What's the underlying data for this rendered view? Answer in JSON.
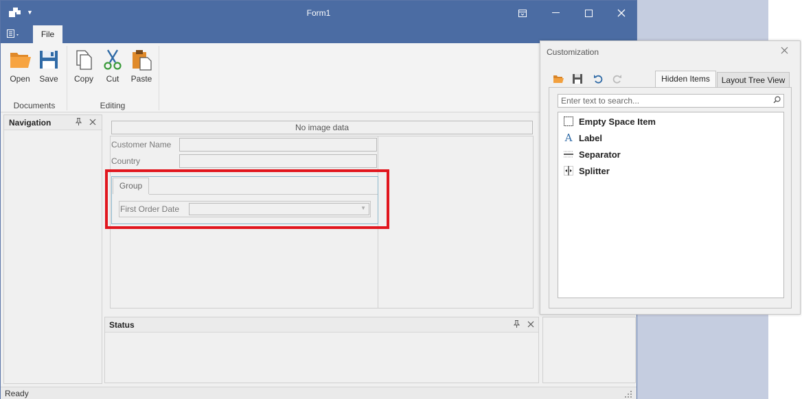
{
  "window": {
    "title": "Form1",
    "ribbon_tab_file": "File",
    "accent": "#4b6ca3"
  },
  "ribbon": {
    "groups": [
      {
        "label": "Documents",
        "buttons": [
          {
            "label": "Open",
            "icon": "folder-open-icon"
          },
          {
            "label": "Save",
            "icon": "floppy-disk-icon"
          }
        ]
      },
      {
        "label": "Editing",
        "buttons": [
          {
            "label": "Copy",
            "icon": "copy-icon"
          },
          {
            "label": "Cut",
            "icon": "scissors-icon"
          },
          {
            "label": "Paste",
            "icon": "clipboard-paste-icon"
          }
        ]
      }
    ]
  },
  "navigation": {
    "title": "Navigation"
  },
  "layout": {
    "image_placeholder": "No image data",
    "fields": [
      {
        "label": "Customer Name"
      },
      {
        "label": "Country"
      }
    ],
    "group": {
      "tab_label": "Group",
      "field_label": "First Order Date"
    },
    "highlight_color": "#e1161e"
  },
  "status_panel": {
    "title": "Status"
  },
  "status_bar": {
    "text": "Ready"
  },
  "customization": {
    "title": "Customization",
    "tabs": [
      "Hidden Items",
      "Layout Tree View"
    ],
    "search_placeholder": "Enter text to search...",
    "items": [
      {
        "label": "Empty Space Item",
        "icon": "empty-space-icon"
      },
      {
        "label": "Label",
        "icon": "label-a-icon"
      },
      {
        "label": "Separator",
        "icon": "separator-icon"
      },
      {
        "label": "Splitter",
        "icon": "splitter-icon"
      }
    ]
  }
}
